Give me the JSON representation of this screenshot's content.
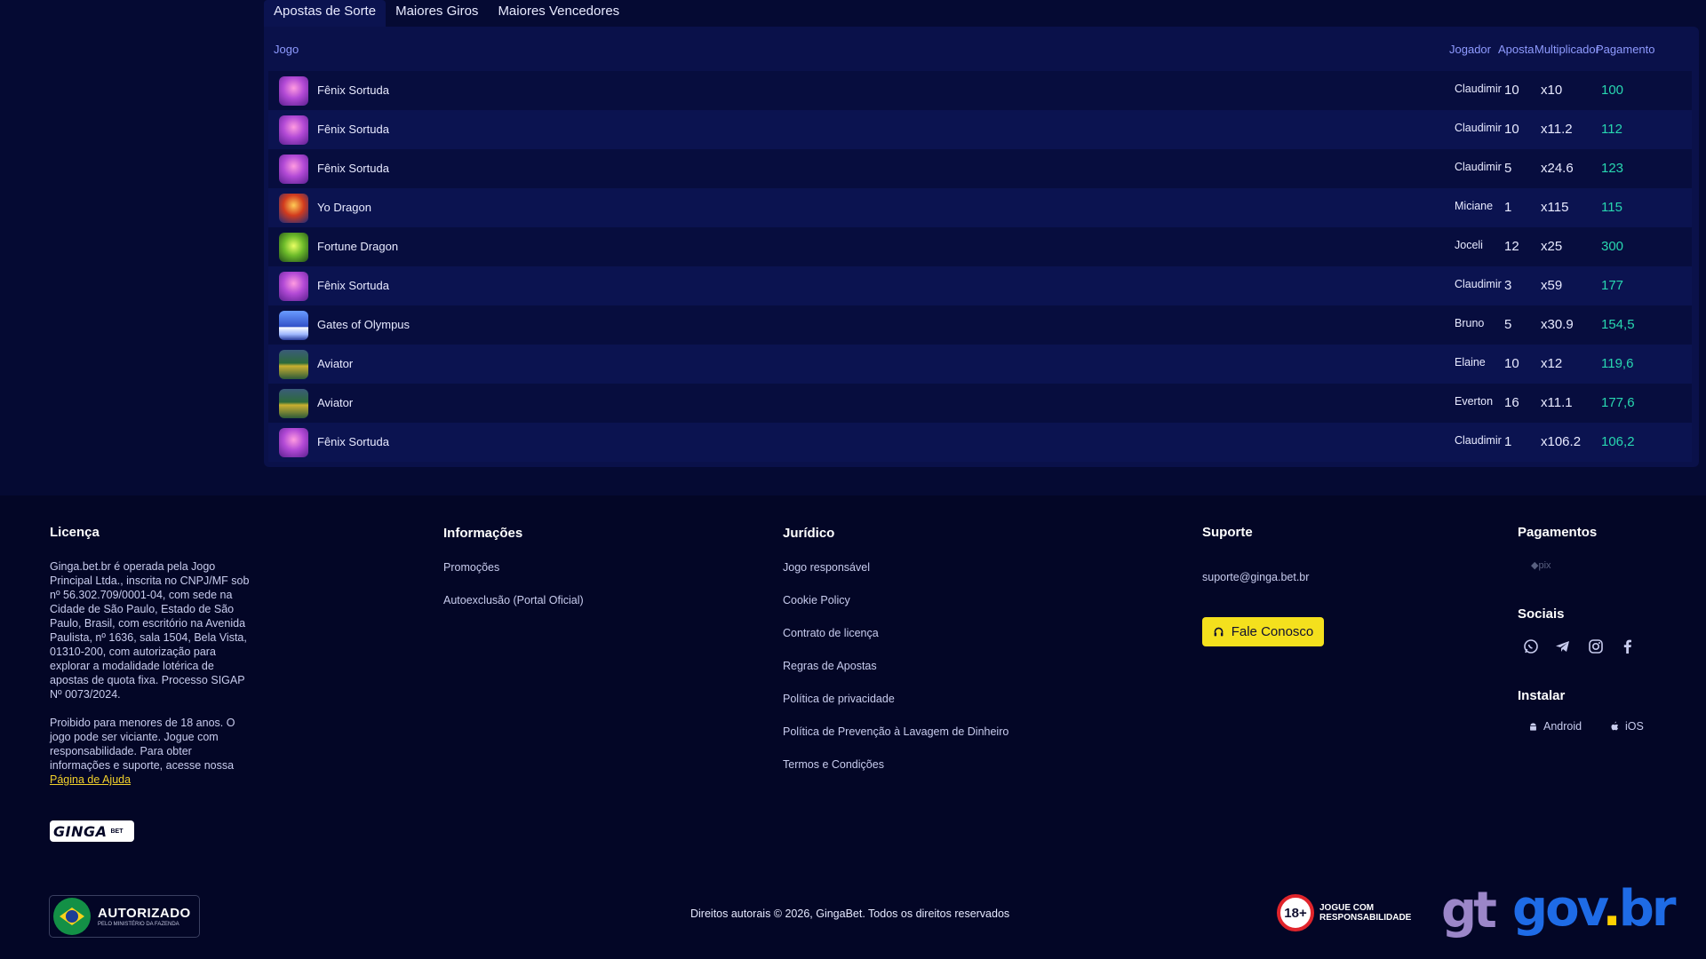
{
  "tabs": [
    "Apostas de Sorte",
    "Maiores Giros",
    "Maiores Vencedores"
  ],
  "table": {
    "headers": {
      "game": "Jogo",
      "player": "Jogador",
      "bet": "Aposta",
      "mult": "Multiplicador",
      "pay": "Pagamento"
    },
    "rows": [
      {
        "thumb": "fenix",
        "game": "Fênix Sortuda",
        "player": "Claudimir",
        "bet": "10",
        "mult": "x10",
        "pay": "100"
      },
      {
        "thumb": "fenix",
        "game": "Fênix Sortuda",
        "player": "Claudimir",
        "bet": "10",
        "mult": "x11.2",
        "pay": "112"
      },
      {
        "thumb": "fenix",
        "game": "Fênix Sortuda",
        "player": "Claudimir",
        "bet": "5",
        "mult": "x24.6",
        "pay": "123"
      },
      {
        "thumb": "dragon",
        "game": "Yo Dragon",
        "player": "Miciane",
        "bet": "1",
        "mult": "x115",
        "pay": "115"
      },
      {
        "thumb": "fortune",
        "game": "Fortune Dragon",
        "player": "Joceli",
        "bet": "12",
        "mult": "x25",
        "pay": "300"
      },
      {
        "thumb": "fenix",
        "game": "Fênix Sortuda",
        "player": "Claudimir",
        "bet": "3",
        "mult": "x59",
        "pay": "177"
      },
      {
        "thumb": "gates",
        "game": "Gates of Olympus",
        "player": "Bruno",
        "bet": "5",
        "mult": "x30.9",
        "pay": "154,5"
      },
      {
        "thumb": "aviator",
        "game": "Aviator",
        "player": "Elaine",
        "bet": "10",
        "mult": "x12",
        "pay": "119,6"
      },
      {
        "thumb": "aviator",
        "game": "Aviator",
        "player": "Everton",
        "bet": "16",
        "mult": "x11.1",
        "pay": "177,6"
      },
      {
        "thumb": "fenix",
        "game": "Fênix Sortuda",
        "player": "Claudimir",
        "bet": "1",
        "mult": "x106.2",
        "pay": "106,2"
      }
    ]
  },
  "footer": {
    "license": {
      "title": "Licença",
      "text1": "Ginga.bet.br é operada pela Jogo Principal Ltda., inscrita no CNPJ/MF sob nº 56.302.709/0001-04, com sede na Cidade de São Paulo, Estado de São Paulo, Brasil, com escritório na Avenida Paulista, nº 1636, sala 1504, Bela Vista, 01310-200, com autorização para explorar a modalidade lotérica de apostas de quota fixa. Processo SIGAP Nº 0073/2024.",
      "text2": "Proibido para menores de 18 anos. O jogo pode ser viciante. Jogue com responsabilidade. Para obter informações e suporte, acesse nossa",
      "help_link": "Página de Ajuda"
    },
    "info": {
      "title": "Informações",
      "links": [
        "Promoções",
        "Autoexclusão (Portal Oficial)"
      ]
    },
    "legal": {
      "title": "Jurídico",
      "links": [
        "Jogo responsável",
        "Cookie Policy",
        "Contrato de licença",
        "Regras de Apostas",
        "Política de privacidade",
        "Política de Prevenção à Lavagem de Dinheiro",
        "Termos e Condições"
      ]
    },
    "support": {
      "title": "Suporte",
      "email": "suporte@ginga.bet.br",
      "button": "Fale Conosco"
    },
    "payments": {
      "title": "Pagamentos",
      "method": "pix"
    },
    "socials": {
      "title": "Sociais",
      "icons": [
        "whatsapp-icon",
        "telegram-icon",
        "instagram-icon",
        "facebook-icon"
      ]
    },
    "install": {
      "title": "Instalar",
      "android": "Android",
      "ios": "iOS"
    },
    "logo": {
      "brand": "GINGA",
      "sub": "BET"
    },
    "authorized": {
      "title": "AUTORIZADO",
      "sub": "PELO MINISTÉRIO DA FAZENDA"
    },
    "copyright": "Direitos autorais © 2026, GingaBet. Todos os direitos reservados",
    "badge18": {
      "age": "18+",
      "line1": "JOGUE COM",
      "line2": "RESPONSABILIDADE"
    },
    "gt": "gt",
    "govbr": {
      "gov": "gov",
      "dot": ".",
      "br": "br"
    }
  },
  "colors": {
    "accent_yellow": "#f4e01d",
    "payout_green": "#28d7b0",
    "header_blue": "#8f9bff",
    "background": "#050a33"
  }
}
